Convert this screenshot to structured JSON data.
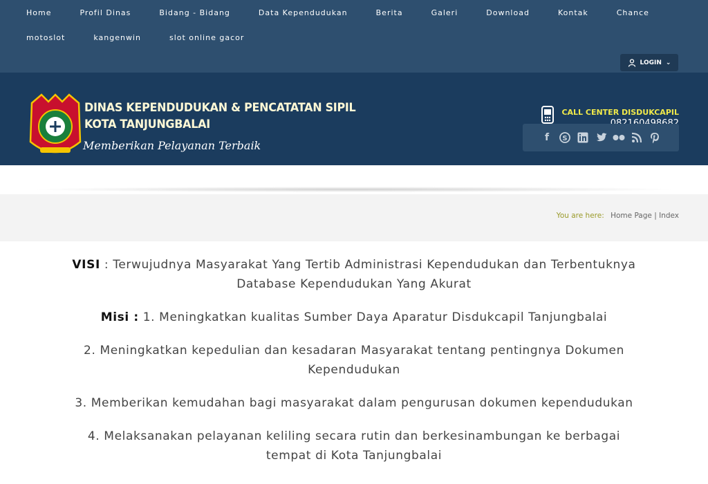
{
  "nav": {
    "row1": [
      "Home",
      "Profil Dinas",
      "Bidang - Bidang",
      "Data Kependudukan",
      "Berita",
      "Galeri",
      "Download",
      "Kontak",
      "Chance"
    ],
    "row2": [
      "motoslot",
      "kangenwin",
      "slot online gacor"
    ]
  },
  "login": {
    "label": "LOGIN"
  },
  "logo": {
    "line1": "DINAS KEPENDUDUKAN & PENCATATAN SIPIL",
    "line2": "KOTA TANJUNGBALAI",
    "tagline": "Memberikan Pelayanan Terbaik"
  },
  "call_center": {
    "label": "CALL CENTER DISDUKCAPIL",
    "number": "082160498682"
  },
  "social_icons": [
    "facebook-icon",
    "skype-icon",
    "linkedin-icon",
    "twitter-icon",
    "flickr-icon",
    "rss-icon",
    "pinterest-icon"
  ],
  "breadcrumb": {
    "label": "You are here:",
    "home": "Home Page",
    "sep": "|",
    "current": "Index"
  },
  "content": {
    "visi_label": "VISI",
    "visi_sep": " : ",
    "visi_text": "Terwujudnya Masyarakat Yang Tertib Administrasi Kependudukan dan Terbentuknya Database Kependudukan Yang Akurat",
    "misi_label": "Misi :",
    "misi_1": " 1. Meningkatkan kualitas Sumber Daya Aparatur Disdukcapil Tanjungbalai",
    "misi_2": "2. Meningkatkan kepedulian dan kesadaran Masyarakat tentang pentingnya Dokumen Kependudukan",
    "misi_3": "3. Memberikan kemudahan bagi masyarakat dalam pengurusan dokumen kependudukan",
    "misi_4": "4. Melaksanakan pelayanan keliling secara rutin dan berkesinambungan ke berbagai tempat di Kota Tanjungbalai"
  }
}
